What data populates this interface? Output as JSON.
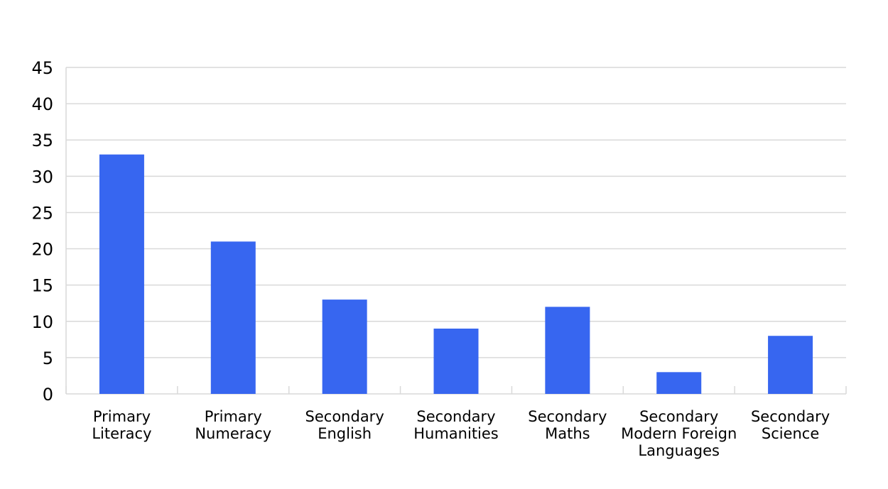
{
  "chart_data": {
    "type": "bar",
    "title": "",
    "xlabel": "",
    "ylabel": "",
    "categories": [
      [
        "Primary",
        "Literacy"
      ],
      [
        "Primary",
        "Numeracy"
      ],
      [
        "Secondary",
        "English"
      ],
      [
        "Secondary",
        "Humanities"
      ],
      [
        "Secondary",
        "Maths"
      ],
      [
        "Secondary",
        "Modern Foreign",
        "Languages"
      ],
      [
        "Secondary",
        "Science"
      ]
    ],
    "values": [
      33,
      21,
      13,
      9,
      12,
      3,
      8
    ],
    "ylim": [
      0,
      45
    ],
    "yticks": [
      "0",
      "5",
      "10",
      "15",
      "20",
      "25",
      "30",
      "35",
      "40",
      "45"
    ],
    "grid": true,
    "legend": "none",
    "bar_color": "#3766F0",
    "grid_color": "#D9D9D9"
  }
}
